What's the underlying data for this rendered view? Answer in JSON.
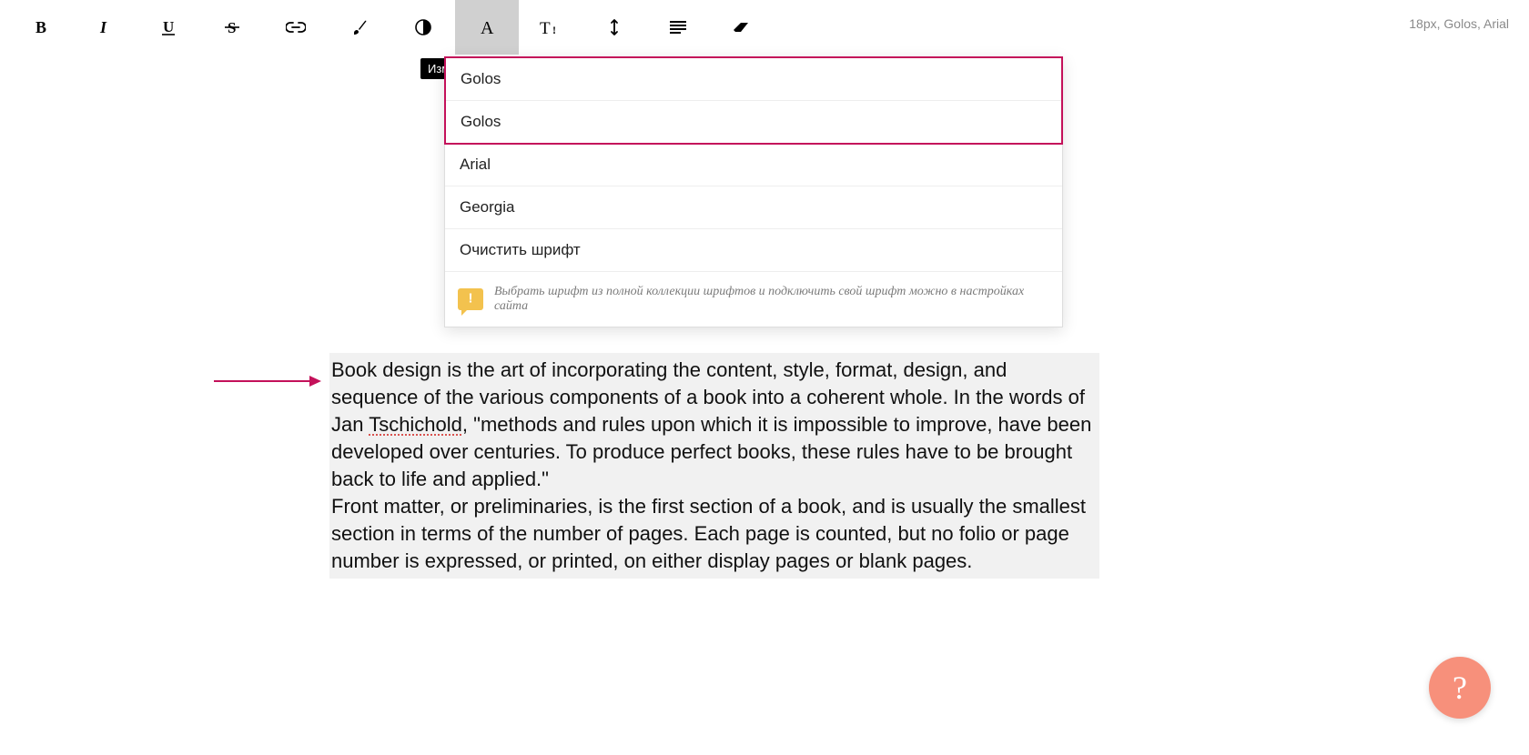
{
  "status_text": "18px, Golos, Arial",
  "tooltip": "Изм",
  "toolbar": {
    "bold": "B",
    "italic": "I",
    "underline": "U",
    "strike": "S",
    "link": "link",
    "color": "brush",
    "contrast": "contrast",
    "font": "A",
    "text_size": "T!",
    "line_height": "arrow",
    "align": "align",
    "eraser": "eraser"
  },
  "dropdown": {
    "items_highlighted": [
      "Golos",
      "Golos"
    ],
    "items_rest": [
      "Arial",
      "Georgia",
      "Очистить шрифт"
    ],
    "hint": "Выбрать шрифт из полной коллекции шрифтов и подключить свой шрифт можно в настройках сайта"
  },
  "text": {
    "p1a": "Book design is the art of incorporating the content, style, format, design, and sequence of the various components of a book into a coherent whole. In the words of Jan ",
    "p1_spell": "Tschichold",
    "p1b": ", \"methods and rules upon which it is impossible to improve, have been developed over centuries. To produce perfect books, these rules have to be brought back to life and applied.\"",
    "p2": "Front matter, or preliminaries, is the first section of a book, and is usually the smallest section in terms of the number of pages. Each page is counted, but no folio or page number is expressed, or printed, on either display pages or blank pages."
  },
  "help": "?"
}
